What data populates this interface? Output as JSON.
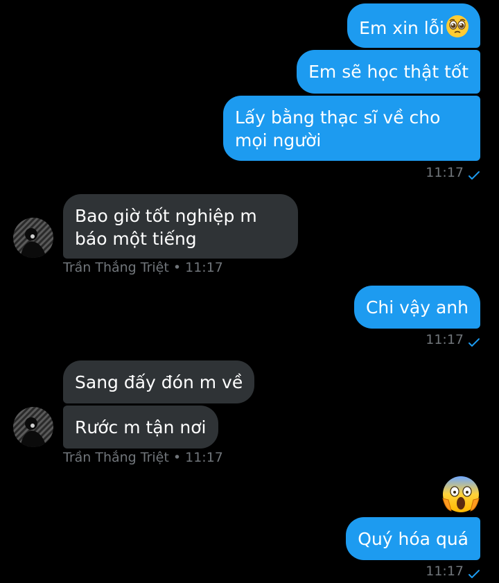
{
  "messages": {
    "m1": "Em xin lỗi",
    "m2": "Em sẽ học thật tốt",
    "m3": "Lấy bằng thạc sĩ về cho mọi người",
    "t1": "11:17",
    "r1": "Bao giờ tốt nghiệp m báo một tiếng",
    "r1_meta": "Trần Thắng Triệt • 11:17",
    "m4": "Chi vậy anh",
    "t2": "11:17",
    "r2": "Sang đấy đón m về",
    "r3": "Rước m tận nơi",
    "r2_meta": "Trần Thắng Triệt • 11:17",
    "m5": "Quý hóa quá",
    "t3": "11:17"
  },
  "colors": {
    "outgoing_bubble": "#1d9bf0",
    "incoming_bubble": "#2f3336",
    "meta_text": "#71767b",
    "read_check": "#1d9bf0"
  },
  "icons": {
    "pleading_face": "pleading-face-emoji",
    "screaming_face": "screaming-face-emoji",
    "read_check": "checkmark-icon"
  }
}
